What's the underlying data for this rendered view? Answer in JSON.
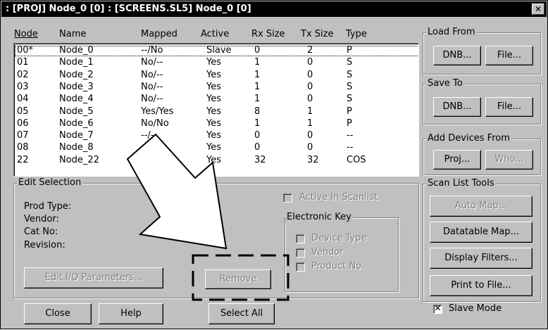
{
  "window": {
    "title": ": [PROJ] Node_0 [0] : [SCREENS.SL5] Node_0 [0]",
    "close_glyph": "✕"
  },
  "columns": {
    "node": "Node",
    "name": "Name",
    "mapped": "Mapped",
    "active": "Active",
    "rx": "Rx Size",
    "tx": "Tx Size",
    "type": "Type"
  },
  "rows": [
    {
      "node": "00*",
      "name": "Node_0",
      "mapped": "--/No",
      "active": "Slave",
      "rx": "0",
      "tx": "2",
      "type": "P"
    },
    {
      "node": "01",
      "name": "Node_1",
      "mapped": "No/--",
      "active": "Yes",
      "rx": "1",
      "tx": "0",
      "type": "S"
    },
    {
      "node": "02",
      "name": "Node_2",
      "mapped": "No/--",
      "active": "Yes",
      "rx": "1",
      "tx": "0",
      "type": "S"
    },
    {
      "node": "03",
      "name": "Node_3",
      "mapped": "No/--",
      "active": "Yes",
      "rx": "1",
      "tx": "0",
      "type": "S"
    },
    {
      "node": "04",
      "name": "Node_4",
      "mapped": "No/--",
      "active": "Yes",
      "rx": "1",
      "tx": "0",
      "type": "S"
    },
    {
      "node": "05",
      "name": "Node_5",
      "mapped": "Yes/Yes",
      "active": "Yes",
      "rx": "8",
      "tx": "1",
      "type": "P"
    },
    {
      "node": "06",
      "name": "Node_6",
      "mapped": "No/No",
      "active": "Yes",
      "rx": "1",
      "tx": "1",
      "type": "P"
    },
    {
      "node": "07",
      "name": "Node_7",
      "mapped": "--/--",
      "active": "Yes",
      "rx": "0",
      "tx": "0",
      "type": "--"
    },
    {
      "node": "08",
      "name": "Node_8",
      "mapped": "--/--",
      "active": "Yes",
      "rx": "0",
      "tx": "0",
      "type": "--"
    },
    {
      "node": "22",
      "name": "Node_22",
      "mapped": "No/Yes",
      "active": "Yes",
      "rx": "32",
      "tx": "32",
      "type": "COS"
    }
  ],
  "load_from": {
    "label": "Load From",
    "dnb": "DNB...",
    "file": "File..."
  },
  "save_to": {
    "label": "Save To",
    "dnb": "DNB...",
    "file": "File..."
  },
  "add_devices": {
    "label": "Add Devices From",
    "proj": "Proj...",
    "who": "Who..."
  },
  "scan_tools": {
    "label": "Scan List Tools",
    "auto_map": "Auto Map...",
    "datatable_map": "Datatable Map...",
    "display_filters": "Display Filters...",
    "print_to_file": "Print to File..."
  },
  "edit_selection": {
    "label": "Edit Selection",
    "prod_type": "Prod Type:",
    "vendor": "Vendor:",
    "cat_no": "Cat No:",
    "revision": "Revision:",
    "edit_io": "Edit I/O Parameters...",
    "remove": "Remove",
    "active_in_scanlist": "Active In Scanlist",
    "electronic_key": "Electronic Key",
    "device_type": "Device Type",
    "vendor_chk": "Vendor",
    "product_no": "Product No."
  },
  "bottom": {
    "close": "Close",
    "help": "Help",
    "select_all": "Select All",
    "slave_mode": "Slave Mode",
    "slave_mode_checked": true
  },
  "colors": {
    "title_bg": "#000000",
    "face": "#c0c0c0",
    "list_bg": "#ffffff",
    "disabled_text": "#808080"
  }
}
